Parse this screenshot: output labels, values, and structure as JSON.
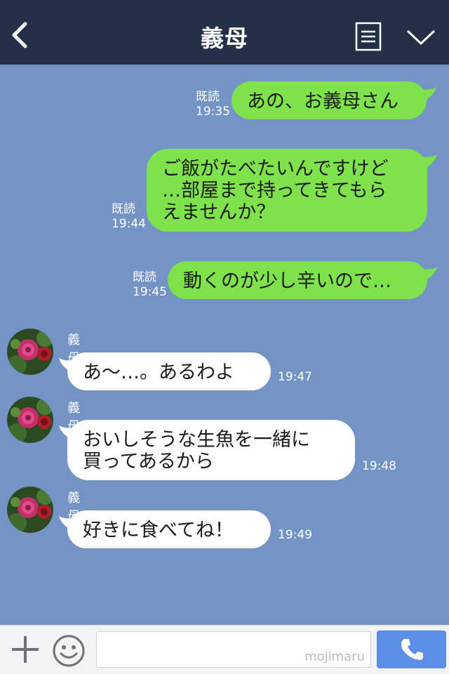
{
  "header": {
    "title": "義母",
    "back_icon": "chevron-left-icon",
    "menu_icon": "menu-icon",
    "expand_icon": "chevron-down-icon"
  },
  "messages": [
    {
      "direction": "out",
      "read_label": "既読",
      "time": "19:35",
      "lines": [
        "あの、お義母さん"
      ]
    },
    {
      "direction": "out",
      "read_label": "既読",
      "time": "19:44",
      "lines": [
        "ご飯がたべたいんですけど",
        "…部屋まで持ってきてもら",
        "えませんか？"
      ]
    },
    {
      "direction": "out",
      "read_label": "既読",
      "time": "19:45",
      "lines": [
        "動くのが少し辛いので…"
      ]
    },
    {
      "direction": "in",
      "sender": "義母",
      "time": "19:47",
      "lines": [
        "あ〜…。あるわよ"
      ]
    },
    {
      "direction": "in",
      "sender": "義母",
      "time": "19:48",
      "lines": [
        "おいしそうな生魚を一緒に",
        "買ってあるから"
      ]
    },
    {
      "direction": "in",
      "sender": "義母",
      "time": "19:49",
      "lines": [
        "好きに食べてね！"
      ]
    }
  ],
  "input_bar": {
    "value": "",
    "watermark": "mojimaru",
    "plus_icon": "plus-icon",
    "sticker_icon": "smile-icon",
    "call_icon": "phone-icon"
  },
  "colors": {
    "header_bg": "#243048",
    "chat_bg": "#7394c4",
    "outgoing_bubble": "#7ee34a",
    "incoming_bubble": "#ffffff",
    "call_button": "#5b8ee6"
  }
}
